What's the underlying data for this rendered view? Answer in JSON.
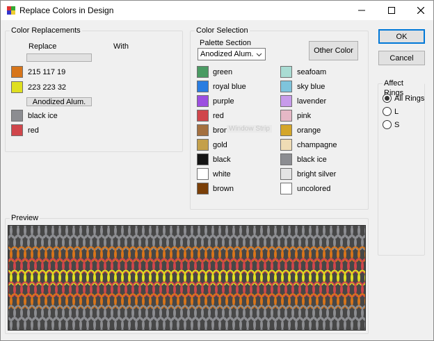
{
  "window": {
    "title": "Replace Colors in Design"
  },
  "color_replacements": {
    "title": "Color Replacements",
    "replace_header": "Replace",
    "with_header": "With",
    "group1_box": "",
    "group1_rows": [
      {
        "label": "215 117 19",
        "color": "#d7751b"
      },
      {
        "label": "223 223 32",
        "color": "#dfdf20"
      }
    ],
    "group2_box": "Anodized Alum.",
    "group2_rows": [
      {
        "label": "black ice",
        "color": "#8c8d91"
      },
      {
        "label": "red",
        "color": "#d0464b"
      }
    ]
  },
  "color_selection": {
    "title": "Color Selection",
    "palette_label": "Palette Section",
    "palette_value": "Anodized Alum.",
    "other_color_label": "Other Color",
    "ghost_text": "Window Strip",
    "left_colors": [
      {
        "label": "green",
        "color": "#4a9b63"
      },
      {
        "label": "royal blue",
        "color": "#2a7de1"
      },
      {
        "label": "purple",
        "color": "#9c4fe0"
      },
      {
        "label": "red",
        "color": "#d0464b"
      },
      {
        "label": "bronze",
        "color": "#a4703f"
      },
      {
        "label": "gold",
        "color": "#c4a04b"
      },
      {
        "label": "black",
        "color": "#141414"
      },
      {
        "label": "white",
        "color": "#ffffff"
      },
      {
        "label": "brown",
        "color": "#7a3f08"
      }
    ],
    "right_colors": [
      {
        "label": "seafoam",
        "color": "#a9dcd3"
      },
      {
        "label": "sky blue",
        "color": "#7ec4dc"
      },
      {
        "label": "lavender",
        "color": "#c79bea"
      },
      {
        "label": "pink",
        "color": "#e6b8c6"
      },
      {
        "label": "orange",
        "color": "#d4a62a"
      },
      {
        "label": "champagne",
        "color": "#efdcb5"
      },
      {
        "label": "black ice",
        "color": "#8c8d91"
      },
      {
        "label": "bright silver",
        "color": "#e4e4e4"
      },
      {
        "label": "uncolored",
        "color": "#ffffff"
      }
    ]
  },
  "buttons": {
    "ok": "OK",
    "cancel": "Cancel"
  },
  "affect_rings": {
    "title": "Affect Rings",
    "options": [
      {
        "label": "All Rings",
        "checked": true
      },
      {
        "label": "L",
        "checked": false
      },
      {
        "label": "S",
        "checked": false
      }
    ]
  },
  "preview": {
    "title": "Preview"
  }
}
